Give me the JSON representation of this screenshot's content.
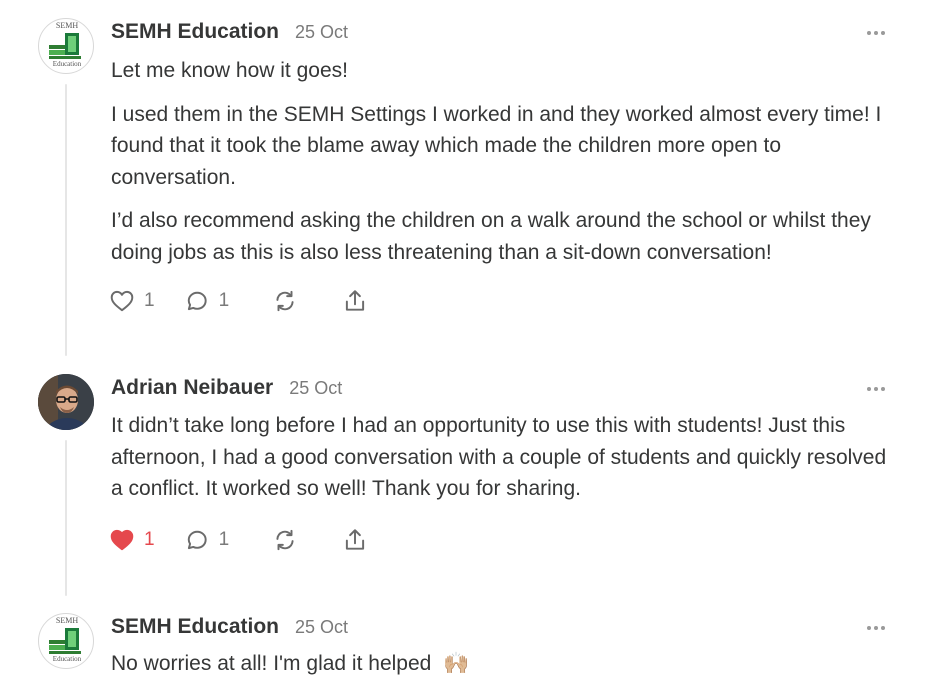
{
  "comments": [
    {
      "author": "SEMH Education",
      "date": "25 Oct",
      "avatar_text_top": "SEMH",
      "avatar_text_bottom": "Education",
      "paragraphs": [
        "Let me know how it goes!",
        "I used them in the SEMH Settings I worked in and they worked almost every time! I found that it took the blame away which made the children more open to conversation.",
        "I’d also recommend asking the children on a walk around the school or whilst they doing jobs as this is also less threatening than a sit-down conversation!"
      ],
      "likes": "1",
      "liked": false,
      "replies": "1"
    },
    {
      "author": "Adrian Neibauer",
      "date": "25 Oct",
      "paragraphs": [
        "It didn’t take long before I had an opportunity to use this with students!  Just this afternoon, I had a good conversation with a couple of students and quickly resolved a conflict. It worked so well! Thank you for sharing."
      ],
      "likes": "1",
      "liked": true,
      "replies": "1"
    },
    {
      "author": "SEMH Education",
      "date": "25 Oct",
      "avatar_text_top": "SEMH",
      "avatar_text_bottom": "Education",
      "paragraphs": [
        "No worries at all! I'm glad it helped"
      ],
      "emoji": "🙌🏼"
    }
  ],
  "icons": {
    "like": "heart-icon",
    "reply": "comment-bubble-icon",
    "restack": "restack-icon",
    "share": "share-icon",
    "more": "more-options-icon"
  },
  "colors": {
    "liked_heart": "#e5484d",
    "icon_gray": "#7a7a7a",
    "thread_line": "#e6e6e6"
  }
}
